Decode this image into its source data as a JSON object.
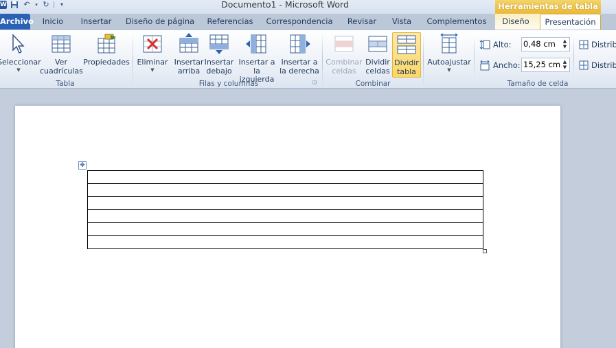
{
  "window": {
    "title": "Documento1  -  Microsoft Word",
    "contextual_header": "Herramientas de tabla"
  },
  "qat": {
    "logo": "W"
  },
  "tabs": [
    {
      "label": "Archivo"
    },
    {
      "label": "Inicio"
    },
    {
      "label": "Insertar"
    },
    {
      "label": "Diseño de página"
    },
    {
      "label": "Referencias"
    },
    {
      "label": "Correspondencia"
    },
    {
      "label": "Revisar"
    },
    {
      "label": "Vista"
    },
    {
      "label": "Complementos"
    },
    {
      "label": "Diseño"
    },
    {
      "label": "Presentación"
    }
  ],
  "ribbon": {
    "tabla": {
      "label": "Tabla",
      "seleccionar": "Seleccionar",
      "ver_line1": "Ver",
      "ver_line2": "cuadrículas",
      "propiedades": "Propiedades"
    },
    "filas": {
      "label": "Filas y columnas",
      "eliminar": "Eliminar",
      "arriba_l1": "Insertar",
      "arriba_l2": "arriba",
      "debajo_l1": "Insertar",
      "debajo_l2": "debajo",
      "izq_l1": "Insertar a",
      "izq_l2": "la izquierda",
      "der_l1": "Insertar a",
      "der_l2": "la derecha"
    },
    "combinar": {
      "label": "Combinar",
      "comb_l1": "Combinar",
      "comb_l2": "celdas",
      "div_l1": "Dividir",
      "div_l2": "celdas",
      "divt_l1": "Dividir",
      "divt_l2": "tabla"
    },
    "tamano": {
      "label": "Tamaño de celda",
      "autoajustar": "Autoajustar",
      "alto_label": "Alto:",
      "alto_value": "0,48 cm",
      "ancho_label": "Ancho:",
      "ancho_value": "15,25 cm",
      "distribuir1": "Distribu",
      "distribuir2": "Distribu"
    }
  },
  "table": {
    "rows": 6
  }
}
